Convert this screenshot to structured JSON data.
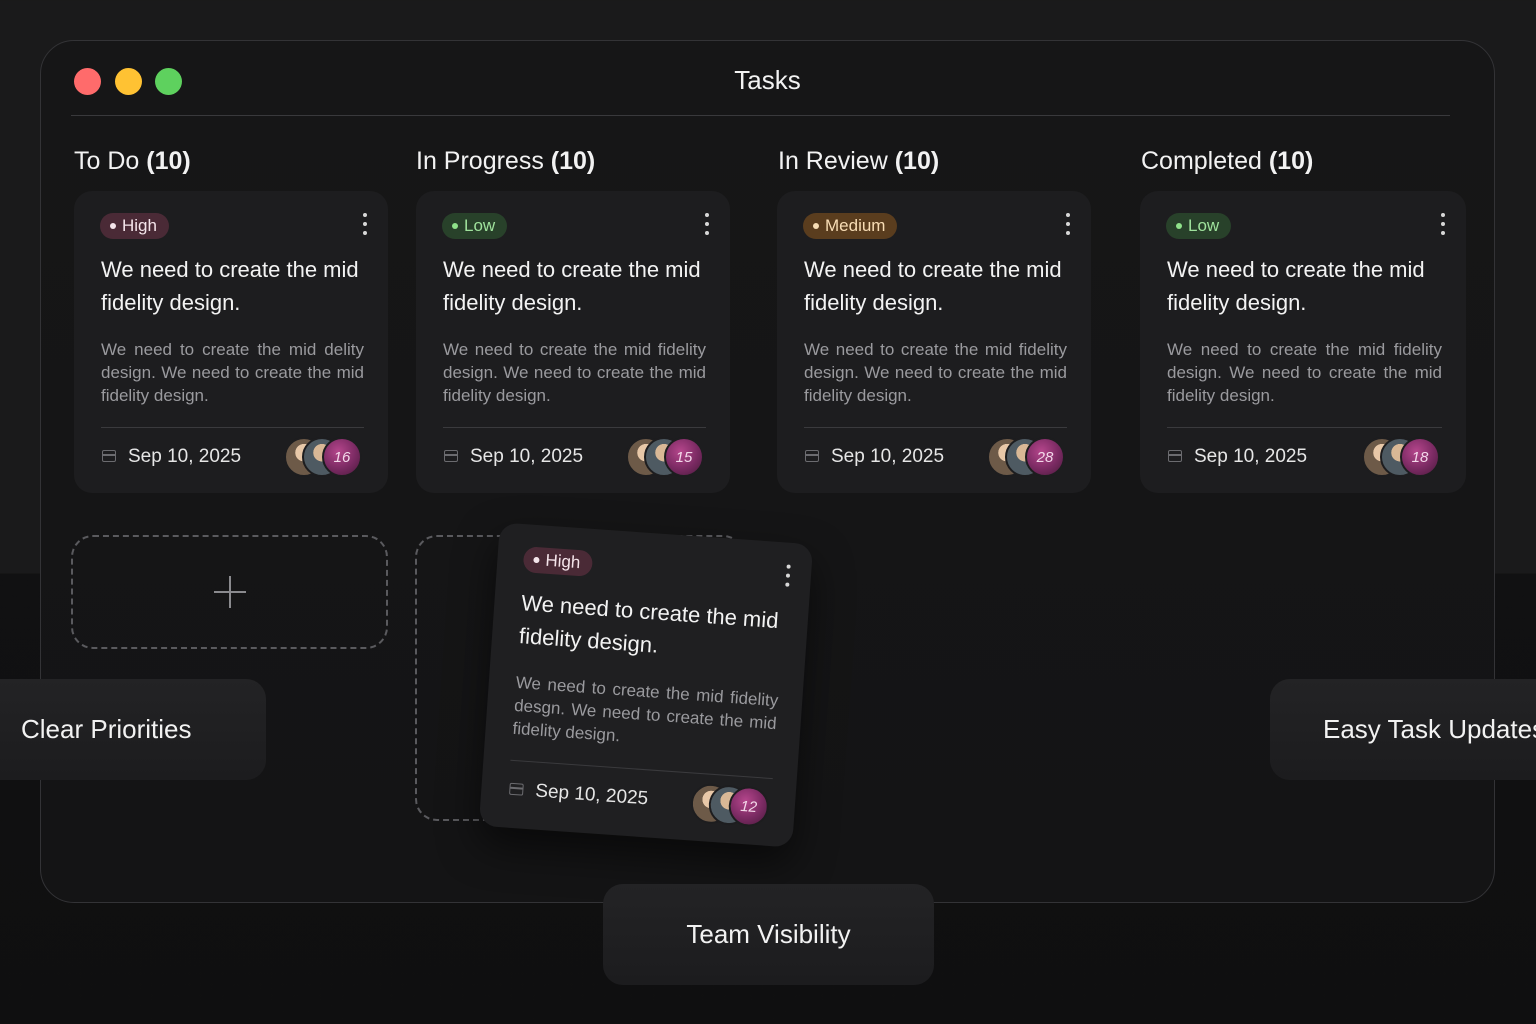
{
  "window": {
    "title": "Tasks"
  },
  "columns": [
    {
      "name": "To Do",
      "count": "(10)"
    },
    {
      "name": "In Progress",
      "count": "(10)"
    },
    {
      "name": "In Review",
      "count": "(10)"
    },
    {
      "name": "Completed",
      "count": "(10)"
    }
  ],
  "cards": [
    {
      "priority": "High",
      "title": "We need to create the mid fidelity design.",
      "description": "We need to create the mid delity design. We need to create the mid fidelity design.",
      "date": "Sep 10, 2025",
      "avatar_count": "16"
    },
    {
      "priority": "Low",
      "title": "We need to create the mid fidelity design.",
      "description": "We need to create the mid fidelity design. We need to create the mid fidelity design.",
      "date": "Sep 10, 2025",
      "avatar_count": "15"
    },
    {
      "priority": "Medium",
      "title": "We need to create the mid fidelity design.",
      "description": "We need to create the mid fidelity design. We need to create the mid fidelity design.",
      "date": "Sep 10, 2025",
      "avatar_count": "28"
    },
    {
      "priority": "Low",
      "title": "We need to create the mid fidelity design.",
      "description": "We need to create the mid fidelity design. We need to create the mid fidelity design.",
      "date": "Sep 10, 2025",
      "avatar_count": "18"
    }
  ],
  "dragged_card": {
    "priority": "High",
    "title": "We need to create the mid fidelity design.",
    "description": "We need to create the mid fidelity desgn. We need to create the mid fidelity design.",
    "date": "Sep 10, 2025",
    "avatar_count": "12"
  },
  "features": {
    "left": "Clear Priorities",
    "right": "Easy Task Updates",
    "bottom": "Team Visibility"
  },
  "colors": {
    "high": "#4a2a36",
    "low": "#28412a",
    "medium": "#5a3d1e",
    "traffic_red": "#ff6b6b",
    "traffic_yellow": "#ffc233",
    "traffic_green": "#5ed15e"
  }
}
